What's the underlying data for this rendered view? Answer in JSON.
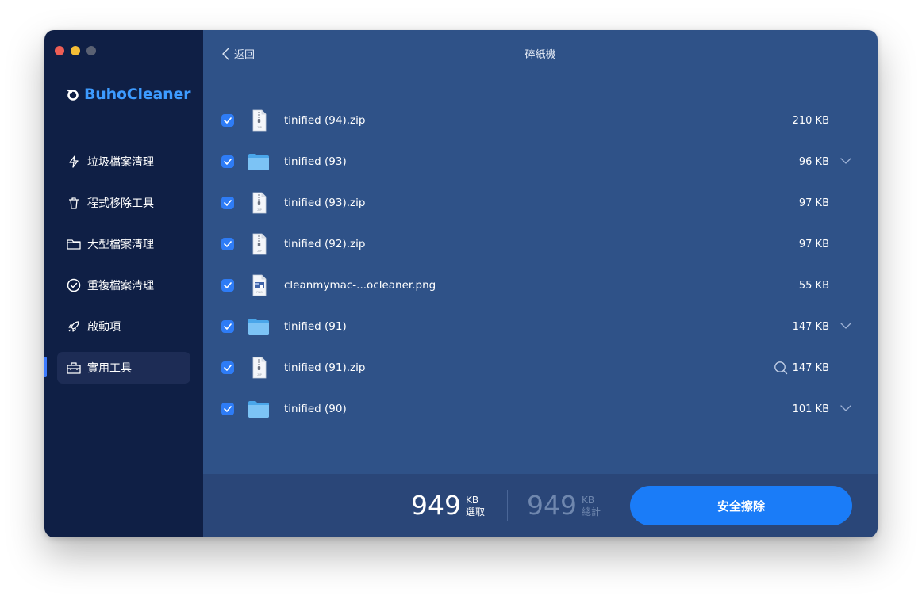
{
  "app": {
    "name": "BuhoCleaner"
  },
  "sidebar": {
    "items": [
      {
        "label": "垃圾檔案清理",
        "icon": "bolt-icon",
        "active": false
      },
      {
        "label": "程式移除工具",
        "icon": "trash-icon",
        "active": false
      },
      {
        "label": "大型檔案清理",
        "icon": "folder-icon",
        "active": false
      },
      {
        "label": "重複檔案清理",
        "icon": "check-circle-icon",
        "active": false
      },
      {
        "label": "啟動項",
        "icon": "rocket-icon",
        "active": false
      },
      {
        "label": "實用工具",
        "icon": "toolbox-icon",
        "active": true
      }
    ]
  },
  "header": {
    "back_label": "返回",
    "title": "碎紙機"
  },
  "files": [
    {
      "name": "tinified (94).zip",
      "size": "210 KB",
      "type": "zip",
      "expandable": false,
      "checked": true
    },
    {
      "name": "tinified (93)",
      "size": "96 KB",
      "type": "folder",
      "expandable": true,
      "checked": true
    },
    {
      "name": "tinified (93).zip",
      "size": "97 KB",
      "type": "zip",
      "expandable": false,
      "checked": true
    },
    {
      "name": "tinified (92).zip",
      "size": "97 KB",
      "type": "zip",
      "expandable": false,
      "checked": true
    },
    {
      "name": "cleanmymac-...ocleaner.png",
      "size": "55 KB",
      "type": "png",
      "expandable": false,
      "checked": true
    },
    {
      "name": "tinified (91)",
      "size": "147 KB",
      "type": "folder",
      "expandable": true,
      "checked": true
    },
    {
      "name": "tinified (91).zip",
      "size": "147 KB",
      "type": "zip",
      "expandable": false,
      "checked": true,
      "preview": true
    },
    {
      "name": "tinified (90)",
      "size": "101 KB",
      "type": "folder",
      "expandable": true,
      "checked": true
    }
  ],
  "footer": {
    "selected_value": "949",
    "selected_unit": "KB",
    "selected_label": "選取",
    "total_value": "949",
    "total_unit": "KB",
    "total_label": "總計",
    "erase_label": "安全擦除"
  },
  "colors": {
    "sidebar_bg": "#0f1f45",
    "main_bg": "#2f5288",
    "footer_bg": "#2a4678",
    "accent": "#1a7cf8",
    "brand": "#3d9bff"
  }
}
